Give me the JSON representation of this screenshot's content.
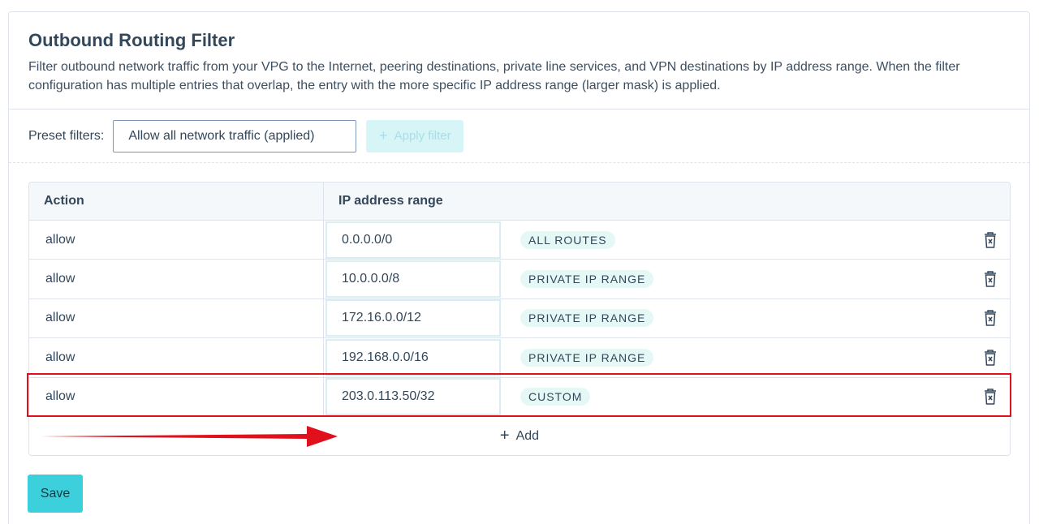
{
  "header": {
    "title": "Outbound Routing Filter",
    "description": "Filter outbound network traffic from your VPG to the Internet, peering destinations, private line services, and VPN destinations by IP address range. When the filter configuration has multiple entries that overlap, the entry with the more specific IP address range (larger mask) is applied."
  },
  "preset": {
    "label": "Preset filters:",
    "selected": "Allow all network traffic (applied)",
    "apply_label": "Apply filter"
  },
  "table": {
    "columns": [
      "Action",
      "IP address range"
    ],
    "rows": [
      {
        "action": "allow",
        "ip": "0.0.0.0/0",
        "tag": "ALL ROUTES"
      },
      {
        "action": "allow",
        "ip": "10.0.0.0/8",
        "tag": "PRIVATE IP RANGE"
      },
      {
        "action": "allow",
        "ip": "172.16.0.0/12",
        "tag": "PRIVATE IP RANGE"
      },
      {
        "action": "allow",
        "ip": "192.168.0.0/16",
        "tag": "PRIVATE IP RANGE"
      },
      {
        "action": "allow",
        "ip": "203.0.113.50/32",
        "tag": "CUSTOM"
      }
    ],
    "add_label": "Add"
  },
  "footer": {
    "save_label": "Save"
  },
  "colors": {
    "accent": "#3ccfdc",
    "highlight": "#e0101c",
    "badge_bg": "#e5f8f6"
  },
  "icons": {
    "delete": "trash-icon",
    "add": "plus-icon"
  }
}
